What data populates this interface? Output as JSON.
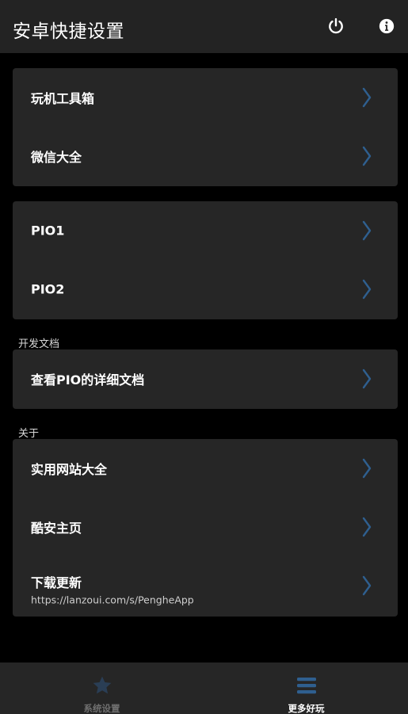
{
  "app_bar": {
    "title": "安卓快捷设置",
    "power_icon": "power-icon",
    "info_icon": "info-icon"
  },
  "colors": {
    "background": "#000000",
    "app_bar": "#232323",
    "card": "#262626",
    "chevron": "#2f5f8f",
    "nav_active": "#ffffff",
    "nav_inactive": "#6f6f6f",
    "nav_icon_active": "#2f5f8f"
  },
  "groups": [
    {
      "items": [
        {
          "label": "玩机工具箱"
        },
        {
          "label": "微信大全"
        }
      ]
    },
    {
      "items": [
        {
          "label": "PIO1"
        },
        {
          "label": "PIO2"
        }
      ]
    },
    {
      "header": "开发文档",
      "items": [
        {
          "label": "查看PIO的详细文档"
        }
      ]
    },
    {
      "header": "关于",
      "items": [
        {
          "label": "实用网站大全"
        },
        {
          "label": "酷安主页"
        },
        {
          "label": "下载更新",
          "subtitle": "https://lanzoui.com/s/PengheApp"
        }
      ]
    }
  ],
  "bottom_nav": {
    "items": [
      {
        "label": "系统设置",
        "icon": "star-icon",
        "active": false
      },
      {
        "label": "更多好玩",
        "icon": "menu-icon",
        "active": true
      }
    ]
  }
}
